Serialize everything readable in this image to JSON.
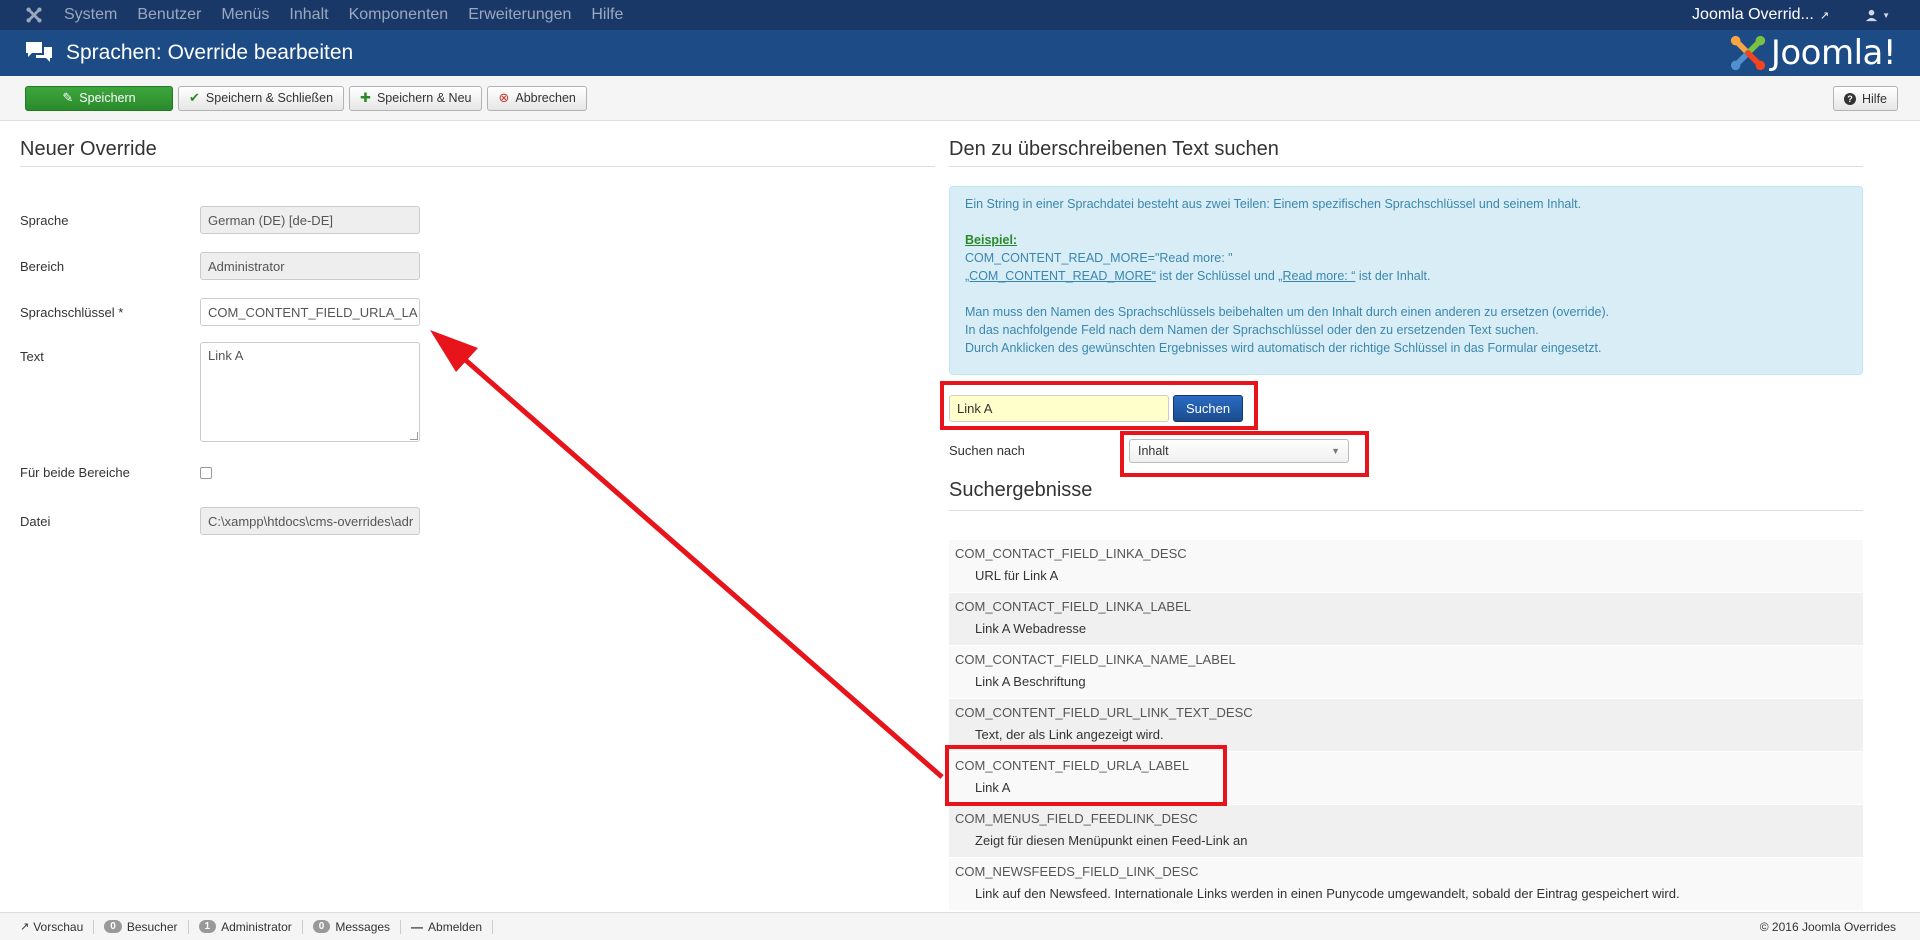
{
  "navbar": {
    "menu": [
      "System",
      "Benutzer",
      "Menüs",
      "Inhalt",
      "Komponenten",
      "Erweiterungen",
      "Hilfe"
    ],
    "site_name": "Joomla Overrid..."
  },
  "header": {
    "title": "Sprachen: Override bearbeiten",
    "logo_text": "Joomla!"
  },
  "toolbar": {
    "save": "Speichern",
    "save_close": "Speichern & Schließen",
    "save_new": "Speichern & Neu",
    "cancel": "Abbrechen",
    "help": "Hilfe"
  },
  "form": {
    "title": "Neuer Override",
    "language_label": "Sprache",
    "language_value": "German (DE) [de-DE]",
    "area_label": "Bereich",
    "area_value": "Administrator",
    "key_label": "Sprachschlüssel *",
    "key_value": "COM_CONTENT_FIELD_URLA_LA",
    "text_label": "Text",
    "text_value": "Link A",
    "both_label": "Für beide Bereiche",
    "file_label": "Datei",
    "file_value": "C:\\xampp\\htdocs\\cms-overrides\\adr"
  },
  "search": {
    "title": "Den zu überschreibenen Text suchen",
    "info_line1": "Ein String in einer Sprachdatei besteht aus zwei Teilen: Einem spezifischen Sprachschlüssel und seinem Inhalt.",
    "example_label": "Beispiel:",
    "example_line": "COM_CONTENT_READ_MORE=\"Read more: \"",
    "example_key": "„COM_CONTENT_READ_MORE“",
    "example_mid": " ist der Schlüssel und ",
    "example_val": "„Read more: “",
    "example_end": " ist der Inhalt.",
    "info_line3": "Man muss den Namen des Sprachschlüssels beibehalten um den Inhalt durch einen anderen zu ersetzen (override).",
    "info_line4": "In das nachfolgende Feld nach dem Namen der Sprachschlüssel oder den zu ersetzenden Text suchen.",
    "info_line5": "Durch Anklicken des gewünschten Ergebnisses wird automatisch der richtige Schlüssel in das Formular eingesetzt.",
    "input_value": "Link A",
    "button": "Suchen",
    "search_by_label": "Suchen nach",
    "search_by_value": "Inhalt",
    "results_title": "Suchergebnisse"
  },
  "results": [
    {
      "key": "COM_CONTACT_FIELD_LINKA_DESC",
      "value": "URL für Link A"
    },
    {
      "key": "COM_CONTACT_FIELD_LINKA_LABEL",
      "value": "Link A Webadresse"
    },
    {
      "key": "COM_CONTACT_FIELD_LINKA_NAME_LABEL",
      "value": "Link A Beschriftung"
    },
    {
      "key": "COM_CONTENT_FIELD_URL_LINK_TEXT_DESC",
      "value": "Text, der als Link angezeigt wird."
    },
    {
      "key": "COM_CONTENT_FIELD_URLA_LABEL",
      "value": "Link A"
    },
    {
      "key": "COM_MENUS_FIELD_FEEDLINK_DESC",
      "value": "Zeigt für diesen Menüpunkt einen Feed-Link an"
    },
    {
      "key": "COM_NEWSFEEDS_FIELD_LINK_DESC",
      "value": "Link auf den Newsfeed. Internationale Links werden in einen Punycode umgewandelt, sobald der Eintrag gespeichert wird."
    }
  ],
  "statusbar": {
    "preview": "Vorschau",
    "visitors_count": "0",
    "visitors": "Besucher",
    "admin_count": "1",
    "admin": "Administrator",
    "messages_count": "0",
    "messages": "Messages",
    "logout": "Abmelden",
    "copyright": "© 2016 Joomla Overrides"
  },
  "colors": {
    "navbar": "#1a3867",
    "header": "#1c4b85",
    "highlight": "#e8141c"
  }
}
